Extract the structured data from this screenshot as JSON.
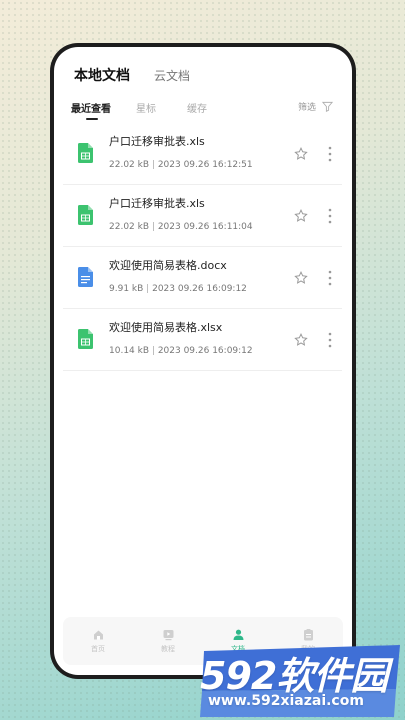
{
  "top_tabs": {
    "local": "本地文档",
    "cloud": "云文档"
  },
  "sub_tabs": {
    "recent": "最近查看",
    "starred": "星标",
    "cache": "缓存",
    "filter": "筛选"
  },
  "files": [
    {
      "name": "户口迁移审批表.xls",
      "size": "22.02 kB",
      "date": "2023 09.26 16:12:51",
      "type": "spreadsheet"
    },
    {
      "name": "户口迁移审批表.xls",
      "size": "22.02 kB",
      "date": "2023 09.26 16:11:04",
      "type": "spreadsheet"
    },
    {
      "name": "欢迎使用简易表格.docx",
      "size": "9.91 kB",
      "date": "2023 09.26 16:09:12",
      "type": "document"
    },
    {
      "name": "欢迎使用简易表格.xlsx",
      "size": "10.14 kB",
      "date": "2023 09.26 16:09:12",
      "type": "spreadsheet"
    }
  ],
  "separator": "|",
  "bottom_nav": [
    {
      "label": "首页",
      "icon": "home-icon",
      "active": false
    },
    {
      "label": "教程",
      "icon": "video-icon",
      "active": false
    },
    {
      "label": "文档",
      "icon": "user-icon",
      "active": true
    },
    {
      "label": "我的",
      "icon": "clipboard-icon",
      "active": false
    }
  ],
  "watermark": {
    "brand": "592软件园",
    "url": "www.592xiazai.com"
  },
  "colors": {
    "accent": "#2fb88a",
    "spreadsheet": "#3cc36f",
    "document": "#4a8ee8",
    "watermark_bg": "#3f6fd6"
  }
}
